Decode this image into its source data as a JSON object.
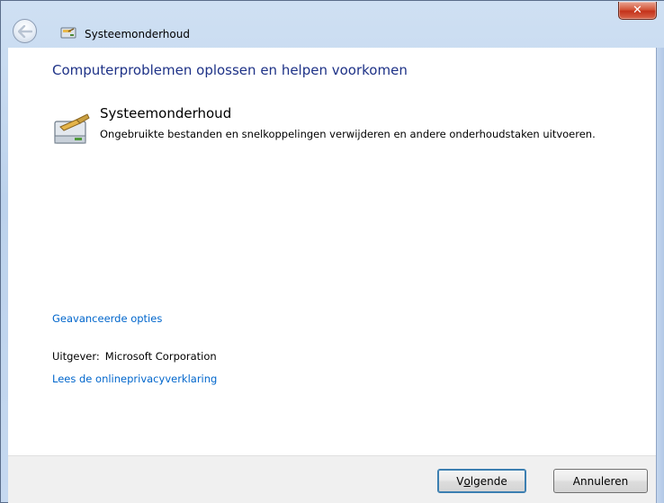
{
  "window": {
    "title": "Systeemonderhoud",
    "close_glyph": "✕"
  },
  "icons": {
    "back": "back-arrow-icon",
    "title": "maintenance-icon",
    "item": "maintenance-icon",
    "close": "close-icon"
  },
  "main": {
    "heading": "Computerproblemen oplossen en helpen voorkomen",
    "item_title": "Systeemonderhoud",
    "item_description": "Ongebruikte bestanden en snelkoppelingen verwijderen en andere onderhoudstaken uitvoeren.",
    "advanced_link": "Geavanceerde opties",
    "publisher_label": "Uitgever:",
    "publisher_value": "Microsoft Corporation",
    "privacy_link": "Lees de onlineprivacyverklaring"
  },
  "footer": {
    "next_prefix": "V",
    "next_underlined": "o",
    "next_suffix": "lgende",
    "cancel_label": "Annuleren"
  },
  "colors": {
    "heading": "#1e3287",
    "link": "#0066cc",
    "close_button": "#c4321a"
  }
}
